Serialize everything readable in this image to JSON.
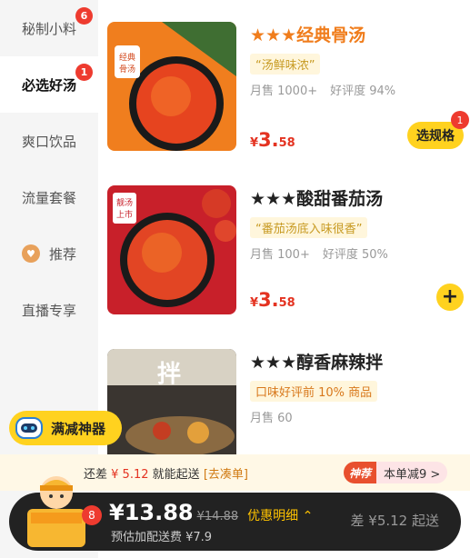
{
  "sidebar": {
    "items": [
      {
        "label": "秘制小料",
        "badge": "6",
        "active": false
      },
      {
        "label": "必选好汤",
        "badge": "1",
        "active": true
      },
      {
        "label": "爽口饮品",
        "badge": "",
        "active": false
      },
      {
        "label": "流量套餐",
        "badge": "",
        "active": false
      },
      {
        "label": "推荐",
        "badge": "",
        "active": false,
        "icon": "recommend-icon"
      },
      {
        "label": "直播专享",
        "badge": "",
        "active": false
      }
    ]
  },
  "products": [
    {
      "name": "★★★经典骨汤",
      "name_color": "#f07d1c",
      "tag": "“汤鲜味浓”",
      "monthly_sales": "月售 1000+",
      "rating": "好评度 94%",
      "price_symbol": "¥",
      "price_int": "3.",
      "price_dec": "58",
      "action_label": "选规格",
      "action_badge": "1",
      "image_text": "经典骨汤"
    },
    {
      "name": "★★★酸甜番茄汤",
      "name_color": "#222222",
      "tag": "“番茄汤底入味很香”",
      "monthly_sales": "月售 100+",
      "rating": "好评度 50%",
      "price_symbol": "¥",
      "price_int": "3.",
      "price_dec": "58",
      "action_label": "+",
      "image_text": "靓汤上市"
    },
    {
      "name": "★★★醇香麻辣拌",
      "name_color": "#222222",
      "tag": "口味好评前 10% 商品",
      "monthly_sales": "月售 60",
      "rating": "",
      "image_text": "拌"
    }
  ],
  "promo": {
    "label": "满减神器"
  },
  "addon": {
    "prefix": "还差",
    "amount": "¥ 5.12",
    "suffix": "就能起送",
    "link": "[去凑单]",
    "hot_label": "神荐",
    "discount": "本单减9 >"
  },
  "cart": {
    "count": "8",
    "total": "¥13.88",
    "original": "¥14.88",
    "detail_label": "优惠明细 ⌃",
    "delivery": "预估加配送费 ¥7.9",
    "min_order": "差 ¥5.12 起送"
  },
  "colors": {
    "accent_yellow": "#ffd21f",
    "price_red": "#e43321",
    "badge_red": "#ee3b2f"
  }
}
